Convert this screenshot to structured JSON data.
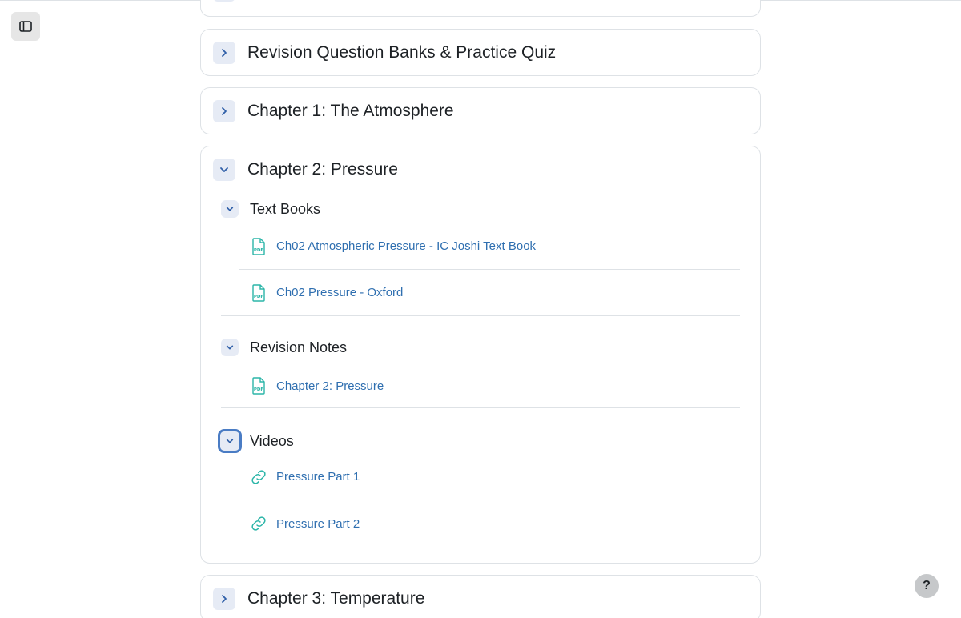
{
  "sections": {
    "revision_bank": {
      "title": "Revision Question Banks & Practice Quiz"
    },
    "chapter1": {
      "title": "Chapter 1: The Atmosphere"
    },
    "chapter2": {
      "title": "Chapter 2: Pressure",
      "text_books": {
        "title": "Text Books",
        "items": [
          {
            "label": "Ch02 Atmospheric Pressure - IC Joshi Text Book",
            "icon": "pdf-icon"
          },
          {
            "label": "Ch02 Pressure - Oxford",
            "icon": "pdf-icon"
          }
        ]
      },
      "revision_notes": {
        "title": "Revision Notes",
        "items": [
          {
            "label": "Chapter 2: Pressure",
            "icon": "pdf-icon"
          }
        ]
      },
      "videos": {
        "title": "Videos",
        "items": [
          {
            "label": "Pressure Part 1",
            "icon": "link-icon"
          },
          {
            "label": "Pressure Part 2",
            "icon": "link-icon"
          }
        ]
      }
    },
    "chapter3": {
      "title": "Chapter 3: Temperature"
    }
  },
  "help": {
    "label": "?"
  },
  "colors": {
    "accent": "#2f6fb0",
    "icon_teal": "#2bb5a8",
    "toggle_bg": "#e6ebf5",
    "border": "#dee2e6"
  }
}
